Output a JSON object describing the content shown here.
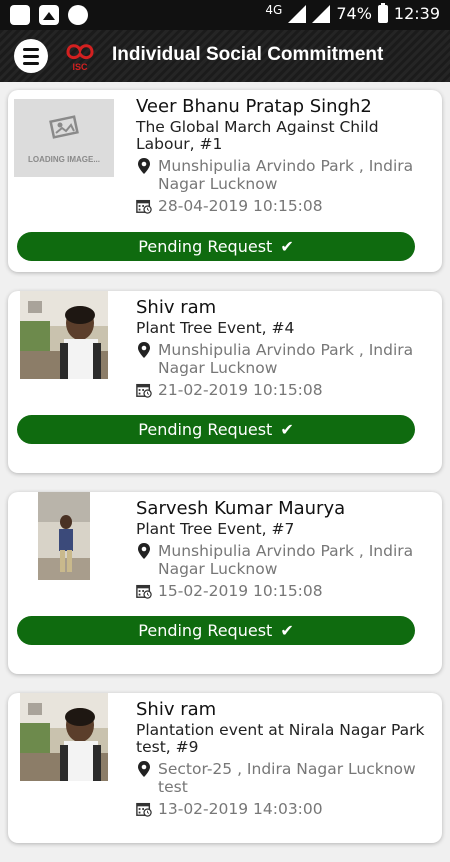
{
  "statusbar": {
    "network": "4G",
    "battery": "74%",
    "time": "12:39"
  },
  "appbar": {
    "logo_text": "ISC",
    "title": "Individual Social Commitment"
  },
  "cards": [
    {
      "name": "Veer Bhanu Pratap Singh2",
      "event": "The Global March Against Child Labour,  #1",
      "location": "Munshipulia Arvindo Park , Indira Nagar Lucknow",
      "datetime": "28-04-2019 10:15:08",
      "status": "Pending Request",
      "image_placeholder": "LOADING IMAGE..."
    },
    {
      "name": "Shiv ram",
      "event": "Plant Tree Event,  #4",
      "location": "Munshipulia Arvindo Park , Indira Nagar Lucknow",
      "datetime": "21-02-2019 10:15:08",
      "status": "Pending Request"
    },
    {
      "name": "Sarvesh Kumar Maurya",
      "event": "Plant Tree Event,  #7",
      "location": "Munshipulia Arvindo Park , Indira Nagar Lucknow",
      "datetime": "15-02-2019 10:15:08",
      "status": "Pending Request"
    },
    {
      "name": "Shiv ram",
      "event": "Plantation event at Nirala Nagar Park test,  #9",
      "location": "Sector-25 , Indira Nagar Lucknow test",
      "datetime": "13-02-2019 14:03:00"
    }
  ],
  "colors": {
    "status_green": "#0f6b0f",
    "appbar_bg": "#1f1f1f",
    "secondary_text": "#777777"
  }
}
